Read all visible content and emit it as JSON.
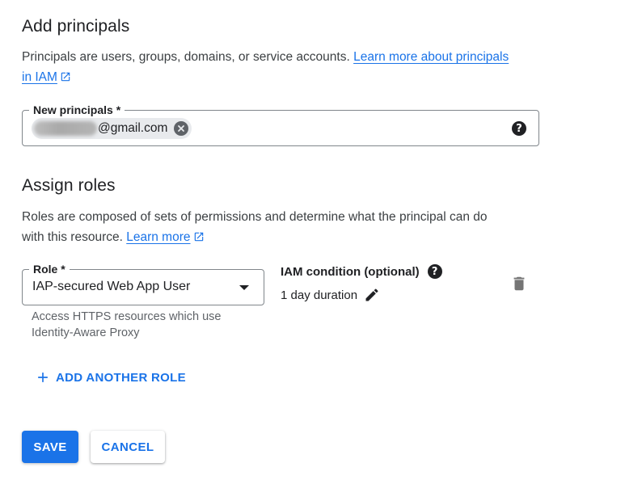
{
  "add_principals": {
    "title": "Add principals",
    "description": "Principals are users, groups, domains, or service accounts.",
    "learn_more_line1": "Learn more about principals",
    "learn_more_line2": "in IAM",
    "field_label": "New principals *",
    "chip_text": "@gmail.com",
    "help_icon": "help-circle-icon"
  },
  "assign_roles": {
    "title": "Assign roles",
    "description_line1": "Roles are composed of sets of permissions and determine what the principal can do",
    "description_line2": "with this resource.",
    "learn_more": "Learn more",
    "role_label": "Role *",
    "role_value": "IAP-secured Web App User",
    "role_hint_line1": "Access HTTPS resources which use",
    "role_hint_line2": "Identity-Aware Proxy",
    "condition_label": "IAM condition (optional)",
    "condition_value": "1 day duration",
    "add_another_role": "ADD ANOTHER ROLE"
  },
  "actions": {
    "save": "SAVE",
    "cancel": "CANCEL"
  },
  "colors": {
    "accent": "#1a73e8",
    "text": "#202124",
    "secondary_text": "#5f6368"
  }
}
